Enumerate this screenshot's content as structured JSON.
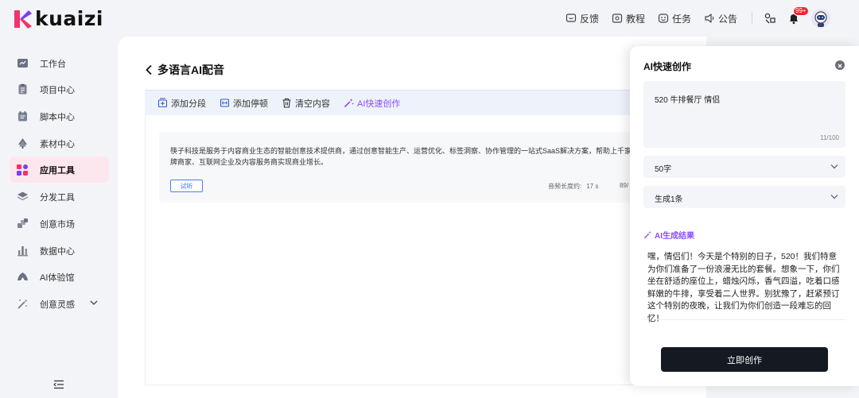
{
  "brand": {
    "logo_text": "kuaizi"
  },
  "header": {
    "links": [
      {
        "label": "反馈",
        "icon": "feedback-icon"
      },
      {
        "label": "教程",
        "icon": "tutorial-icon"
      },
      {
        "label": "任务",
        "icon": "task-icon"
      },
      {
        "label": "公告",
        "icon": "announcement-icon"
      }
    ],
    "notification_badge": "99+"
  },
  "sidebar": {
    "items": [
      {
        "label": "工作台",
        "icon": "dashboard-icon"
      },
      {
        "label": "项目中心",
        "icon": "project-icon"
      },
      {
        "label": "脚本中心",
        "icon": "script-icon"
      },
      {
        "label": "素材中心",
        "icon": "material-icon"
      },
      {
        "label": "应用工具",
        "icon": "app-tools-icon",
        "active": true
      },
      {
        "label": "分发工具",
        "icon": "distribution-icon"
      },
      {
        "label": "创意市场",
        "icon": "market-icon"
      },
      {
        "label": "数据中心",
        "icon": "data-icon"
      },
      {
        "label": "AI体验馆",
        "icon": "ai-hall-icon"
      },
      {
        "label": "创意灵感",
        "icon": "inspiration-icon",
        "expandable": true
      }
    ]
  },
  "main": {
    "title": "多语言AI配音",
    "toolbar": {
      "add_segment": "添加分段",
      "add_pause": "添加停顿",
      "clear": "清空内容",
      "ai_create": "AI快速创作"
    },
    "segment": {
      "text": "筷子科技是服务于内容商业生态的智能创意技术提供商，通过创意智能生产、运营优化、标签洞察、协作管理的一站式SaaS解决方案，帮助上千家品牌商家、互联网企业及内容服务商实现商业增长。",
      "try_label": "试听",
      "duration_label": "音频长度约:",
      "duration_value": "17 s",
      "char_count": "89/"
    }
  },
  "drawer": {
    "title": "AI快速创作",
    "prompt": {
      "value": "520 牛排餐厅 情侣",
      "count": "11/100"
    },
    "length_select": "50字",
    "quantity_select": "生成1条",
    "result_label": "AI生成结果",
    "result_text": "嘿，情侣们！今天是个特别的日子，520！我们特意为你们准备了一份浪漫无比的套餐。想象一下，你们坐在舒适的座位上，蜡烛闪烁，香气四溢，吃着口感鲜嫩的牛排，享受着二人世界。别犹豫了，赶紧预订这个特别的夜晚，让我们为你们创造一段难忘的回忆！",
    "create_button": "立即创作"
  },
  "colors": {
    "brand_pink": "#f5316b",
    "brand_purple": "#7b3ff2",
    "ai_purple": "#8a4dff",
    "link_blue": "#4a7cf5",
    "dark_button": "#141922",
    "active_nav_bg": "#fde7ee"
  }
}
